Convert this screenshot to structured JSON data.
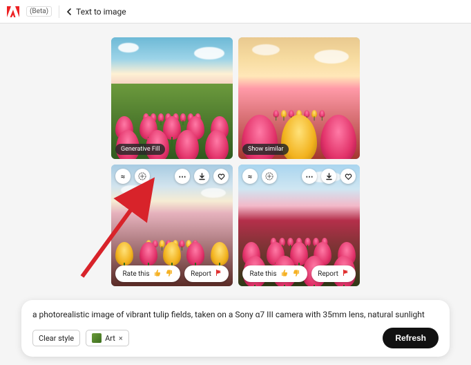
{
  "header": {
    "beta_label": "(Beta)",
    "page_title": "Text to image"
  },
  "tiles": {
    "t1": {
      "hover_label": "Generative Fill"
    },
    "t2": {
      "hover_label": "Show similar"
    },
    "rate_label": "Rate this",
    "report_label": "Report"
  },
  "icons": {
    "similar": "≈",
    "more": "⋯"
  },
  "prompt": {
    "text": "a photorealistic image of vibrant tulip fields, taken on a Sony α7 III camera with 35mm lens, natural sunlight",
    "clear_style_label": "Clear style",
    "style_chip_label": "Art",
    "style_chip_remove": "×",
    "refresh_label": "Refresh"
  }
}
